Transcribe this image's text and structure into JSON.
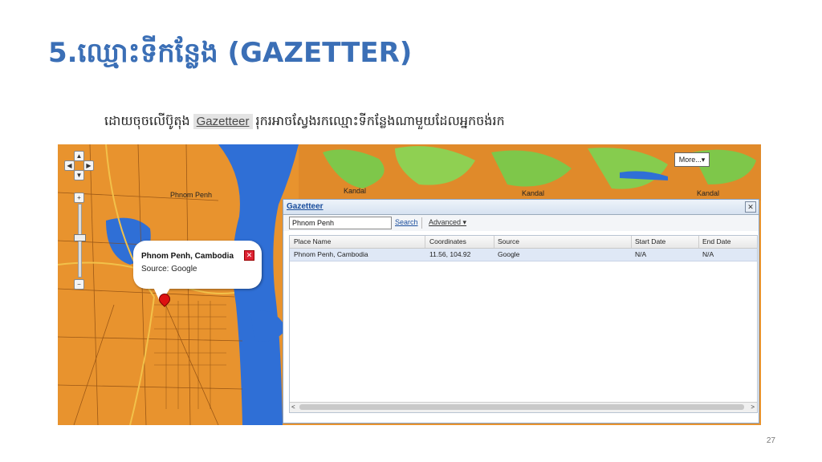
{
  "slide": {
    "title": "5.ឈ្មោះទីកន្លែង (GAZETTER)",
    "subtitle_before": "ដោយចុចលើប៊ូតុង",
    "subtitle_chip": "Gazetteer",
    "subtitle_after": "រុករអាចស្វែងរកឈ្មោះទីកន្លែងណាមួយដែលអ្នកចង់រក",
    "page_number": "27"
  },
  "map": {
    "more_button": "More...",
    "labels": {
      "phnom_penh": "Phnom Penh",
      "kandal_1": "Kandal",
      "kandal_2": "Kandal",
      "kandal_3": "Kandal"
    },
    "popup": {
      "title": "Phnom Penh, Cambodia",
      "source": "Source: Google",
      "close": "✕"
    }
  },
  "gazetteer": {
    "title": "Gazetteer",
    "close": "✕",
    "search_value": "Phnom Penh",
    "search_button": "Search",
    "advanced_button": "Advanced ▾",
    "columns": [
      "Place Name",
      "Coordinates",
      "Source",
      "Start Date",
      "End Date"
    ],
    "rows": [
      [
        "Phnom Penh, Cambodia",
        "11.56, 104.92",
        "Google",
        "N/A",
        "N/A"
      ]
    ],
    "scroll_left": "<",
    "scroll_right": ">"
  },
  "colors": {
    "title": "#3b6fb6",
    "map_land": "#e8932e",
    "river": "#2f6fd6",
    "vegetation": "#7ec74a",
    "pin": "#dd1111"
  }
}
